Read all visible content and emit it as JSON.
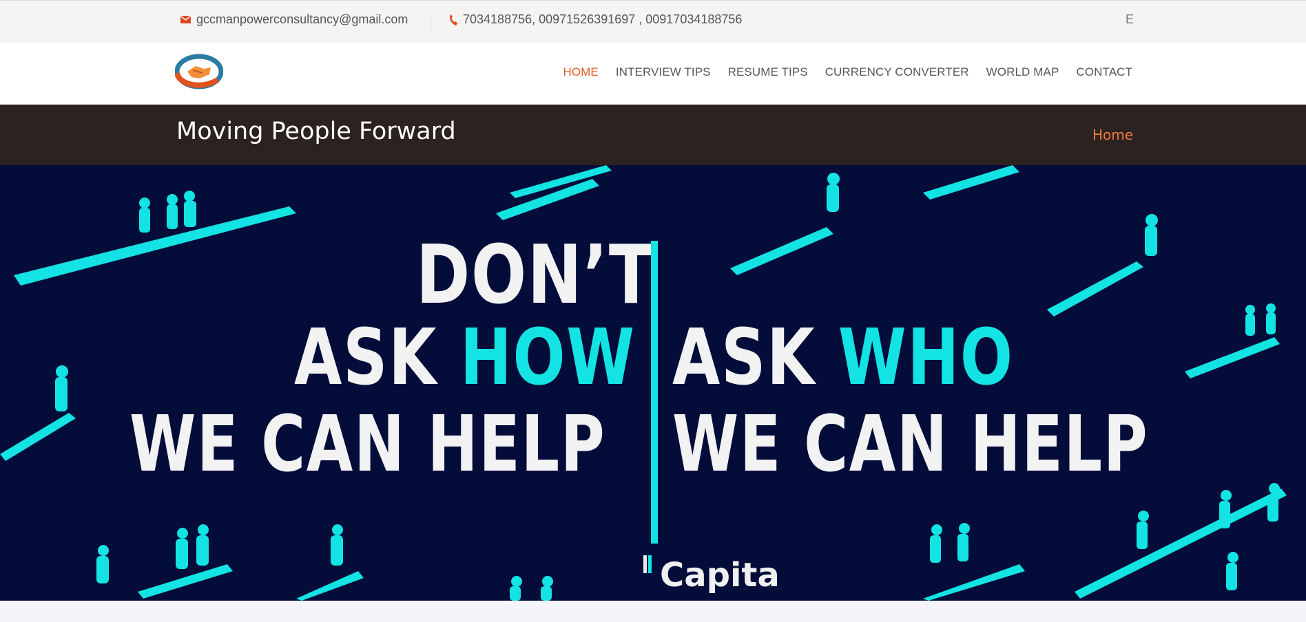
{
  "topbar": {
    "email": "gccmanpowerconsultancy@gmail.com",
    "phone": "7034188756, 00971526391697 , 00917034188756",
    "right_partial": "E"
  },
  "icons": {
    "email": "envelope-icon",
    "phone": "phone-icon",
    "logo": "handshake-logo"
  },
  "nav": {
    "items": [
      {
        "label": "HOME",
        "active": true
      },
      {
        "label": "INTERVIEW TIPS",
        "active": false
      },
      {
        "label": "RESUME TIPS",
        "active": false
      },
      {
        "label": "CURRENCY CONVERTER",
        "active": false
      },
      {
        "label": "WORLD MAP",
        "active": false
      },
      {
        "label": "CONTACT",
        "active": false
      }
    ]
  },
  "banner": {
    "title": "Moving People Forward",
    "breadcrumb": "Home"
  },
  "hero": {
    "line1": "DON’T",
    "ask": "ASK",
    "how": "HOW",
    "who": "WHO",
    "we_can_help": "WE CAN HELP",
    "brand": "Capita"
  },
  "colors": {
    "accent": "#e05e24",
    "banner_bg": "#2c221f",
    "hero_bg": "#040c3a",
    "hero_cyan": "#14e3e3"
  }
}
